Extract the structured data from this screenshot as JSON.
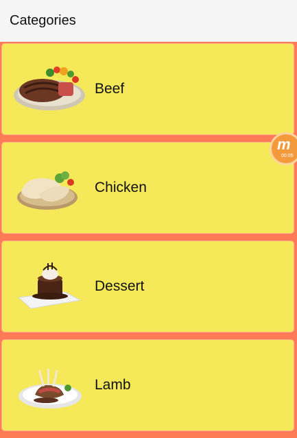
{
  "app_bar": {
    "title": "Categories"
  },
  "categories": [
    {
      "label": "Beef",
      "icon": "beef-steak-plate-image"
    },
    {
      "label": "Chicken",
      "icon": "chicken-legs-plate-image"
    },
    {
      "label": "Dessert",
      "icon": "chocolate-cake-plate-image"
    },
    {
      "label": "Lamb",
      "icon": "lamb-chops-plate-image"
    }
  ],
  "overlay": {
    "recorder_time": "00:05"
  },
  "colors": {
    "background": "#ff7b57",
    "card": "#f5e95a",
    "app_bar": "#f5f5f5"
  }
}
